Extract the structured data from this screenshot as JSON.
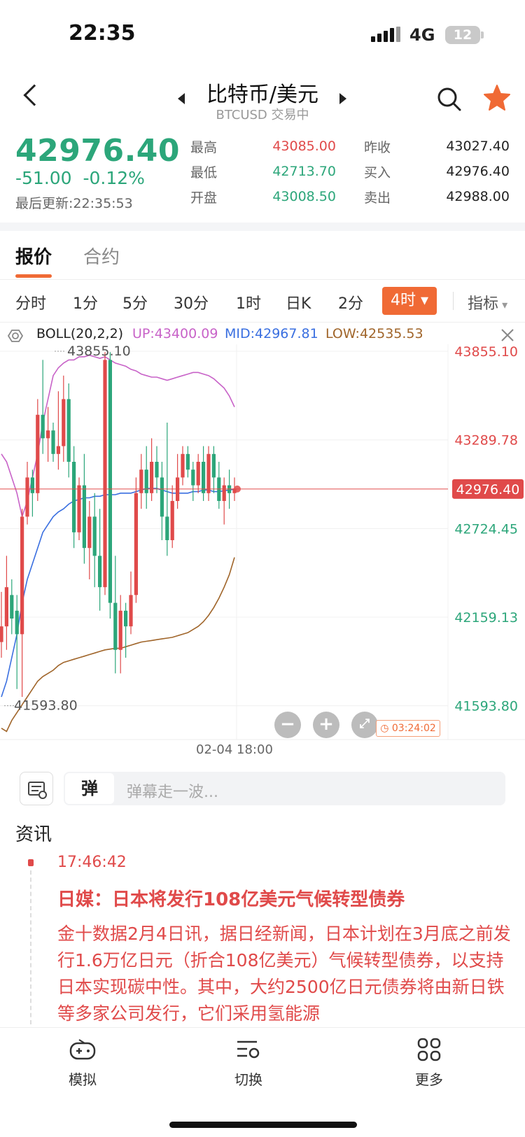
{
  "status_bar": {
    "time": "22:35",
    "network": "4G",
    "battery": "12"
  },
  "header": {
    "title": "比特币/美元",
    "subtitle": "BTCUSD 交易中"
  },
  "quote": {
    "price": "42976.40",
    "change": "-51.00",
    "change_pct": "-0.12%",
    "updated": "最后更新:22:35:53",
    "high_label": "最高",
    "high": "43085.00",
    "low_label": "最低",
    "low": "42713.70",
    "open_label": "开盘",
    "open": "43008.50",
    "prev_close_label": "昨收",
    "prev_close": "43027.40",
    "bid_label": "买入",
    "bid": "42976.40",
    "ask_label": "卖出",
    "ask": "42988.00"
  },
  "colors": {
    "up": "#e04a4a",
    "down": "#2ca67a",
    "accent": "#f06a35",
    "boll_up": "#c863c8",
    "boll_mid": "#3a6fe0",
    "boll_low": "#a0652a"
  },
  "tabs": [
    {
      "label": "报价",
      "active": true
    },
    {
      "label": "合约",
      "active": false
    }
  ],
  "periods": [
    "分时",
    "1分",
    "5分",
    "30分",
    "1时",
    "日K",
    "2分"
  ],
  "active_period": "4时",
  "indicator_label": "指标",
  "boll": {
    "name": "BOLL(20,2,2)",
    "up": "UP:43400.09",
    "mid": "MID:42967.81",
    "low": "LOW:42535.53"
  },
  "chart_data": {
    "type": "candlestick",
    "y_ticks": [
      "43855.10",
      "43289.78",
      "42724.45",
      "42159.13",
      "41593.80"
    ],
    "current_price": "42976.40",
    "max_marker": "43855.10",
    "min_marker": "41593.80",
    "x_label": "02-04 18:00",
    "countdown": "03:24:02",
    "ylim": [
      41400,
      43900
    ],
    "candles": [
      [
        42000,
        42100,
        42320,
        41900
      ],
      [
        42100,
        42350,
        42550,
        41950
      ],
      [
        42300,
        42150,
        42400,
        42050
      ],
      [
        42200,
        42050,
        42300,
        41700
      ],
      [
        42050,
        42800,
        42850,
        41650
      ],
      [
        42800,
        43050,
        43150,
        42750
      ],
      [
        43050,
        42950,
        43100,
        42800
      ],
      [
        42950,
        43450,
        43550,
        42900
      ],
      [
        43450,
        43300,
        43800,
        43200
      ],
      [
        43300,
        43350,
        43500,
        43150
      ],
      [
        43350,
        43200,
        43400,
        43150
      ],
      [
        43200,
        43250,
        43600,
        43100
      ],
      [
        43250,
        43550,
        43700,
        43150
      ],
      [
        43550,
        43150,
        43650,
        43050
      ],
      [
        43150,
        42700,
        43250,
        42600
      ],
      [
        42700,
        43000,
        43050,
        42650
      ],
      [
        43000,
        42600,
        43200,
        42500
      ],
      [
        42600,
        42800,
        42900,
        42400
      ],
      [
        42800,
        42550,
        42950,
        42350
      ],
      [
        42550,
        42350,
        42850,
        42200
      ],
      [
        42350,
        43800,
        43850,
        42300
      ],
      [
        43800,
        42250,
        43850,
        42150
      ],
      [
        42250,
        41950,
        42550,
        41800
      ],
      [
        41950,
        42200,
        42300,
        41800
      ],
      [
        42200,
        42100,
        42250,
        41900
      ],
      [
        42100,
        42300,
        42450,
        42050
      ],
      [
        42300,
        42950,
        43050,
        42250
      ],
      [
        42950,
        43100,
        43200,
        42850
      ],
      [
        43100,
        42950,
        43250,
        42850
      ],
      [
        42950,
        43150,
        43300,
        42900
      ],
      [
        43150,
        43050,
        43250,
        42950
      ],
      [
        43050,
        42800,
        43150,
        42650
      ],
      [
        42800,
        42650,
        43400,
        42550
      ],
      [
        42650,
        42900,
        43000,
        42600
      ],
      [
        42900,
        43050,
        43200,
        42850
      ],
      [
        43050,
        43200,
        43250,
        43000
      ],
      [
        43200,
        43100,
        43250,
        43050
      ],
      [
        43100,
        43000,
        43150,
        42900
      ],
      [
        43000,
        43150,
        43200,
        42950
      ],
      [
        43150,
        42950,
        43250,
        42900
      ],
      [
        42950,
        43200,
        43250,
        42900
      ],
      [
        43200,
        43050,
        43250,
        42950
      ],
      [
        43050,
        42900,
        43150,
        42850
      ],
      [
        42900,
        43000,
        43050,
        42750
      ],
      [
        43000,
        42950,
        43100,
        42850
      ],
      [
        42950,
        42980,
        43050,
        42900
      ]
    ],
    "boll_upper": [
      43200,
      43150,
      43050,
      42950,
      42800,
      42900,
      43050,
      43200,
      43400,
      43550,
      43700,
      43750,
      43780,
      43800,
      43800,
      43820,
      43820,
      43830,
      43820,
      43810,
      43820,
      43800,
      43780,
      43770,
      43760,
      43740,
      43730,
      43710,
      43700,
      43690,
      43690,
      43680,
      43670,
      43680,
      43690,
      43700,
      43710,
      43720,
      43720,
      43710,
      43700,
      43680,
      43650,
      43620,
      43570,
      43500
    ],
    "boll_mid": [
      41650,
      41750,
      41900,
      42050,
      42250,
      42400,
      42500,
      42600,
      42700,
      42750,
      42800,
      42830,
      42850,
      42880,
      42900,
      42910,
      42920,
      42920,
      42930,
      42930,
      42940,
      42940,
      42940,
      42950,
      42950,
      42950,
      42960,
      42970,
      42980,
      42980,
      42980,
      42970,
      42960,
      42950,
      42950,
      42950,
      42950,
      42960,
      42960,
      42970,
      42970,
      42960,
      42960,
      42965,
      42970,
      42975
    ],
    "boll_lower": [
      41450,
      41430,
      41500,
      41550,
      41600,
      41650,
      41700,
      41750,
      41780,
      41800,
      41820,
      41850,
      41870,
      41880,
      41890,
      41900,
      41910,
      41920,
      41930,
      41940,
      41950,
      41955,
      41960,
      41960,
      41970,
      41980,
      41990,
      42000,
      42005,
      42010,
      42015,
      42020,
      42025,
      42030,
      42040,
      42050,
      42060,
      42080,
      42100,
      42130,
      42170,
      42220,
      42280,
      42350,
      42430,
      42540
    ]
  },
  "danmu": {
    "badge": "弹",
    "placeholder": "弹幕走一波..."
  },
  "news": {
    "section": "资讯",
    "time": "17:46:42",
    "title": "日媒：日本将发行108亿美元气候转型债券",
    "body": "金十数据2月4日讯，据日经新闻，日本计划在3月底之前发行1.6万亿日元（折合108亿美元）气候转型债券，以支持日本实现碳中性。其中，大约2500亿日元债券将由新日铁等多家公司发行，它们采用氢能源"
  },
  "bottom_nav": [
    {
      "label": "模拟",
      "icon": "gamepad-icon"
    },
    {
      "label": "切换",
      "icon": "switch-icon"
    },
    {
      "label": "更多",
      "icon": "grid-icon"
    }
  ]
}
